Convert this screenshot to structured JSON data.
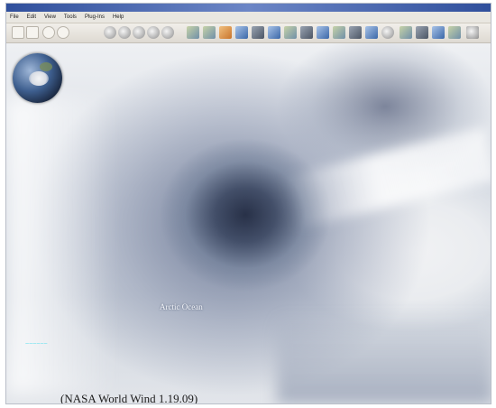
{
  "menu": [
    "File",
    "Edit",
    "View",
    "Tools",
    "Plug-Ins",
    "Help"
  ],
  "toolbar_icons": [
    "back-icon",
    "forward-icon",
    "stop-icon",
    "refresh-icon",
    "zoom-icon",
    "globe-icon",
    "globe-icon",
    "globe-icon",
    "layers-icon",
    "map-icon",
    "map-icon",
    "map-icon",
    "map-icon",
    "map-icon",
    "map-icon",
    "map-icon",
    "map-icon",
    "map-icon",
    "map-icon",
    "map-icon",
    "map-icon",
    "compass-icon",
    "map-icon",
    "map-icon",
    "map-icon",
    "map-icon",
    "map-icon"
  ],
  "map": {
    "ocean_label": "Arctic Ocean",
    "scale_label": "~~~~~~"
  },
  "caption": "(NASA World Wind 1.19.09)"
}
